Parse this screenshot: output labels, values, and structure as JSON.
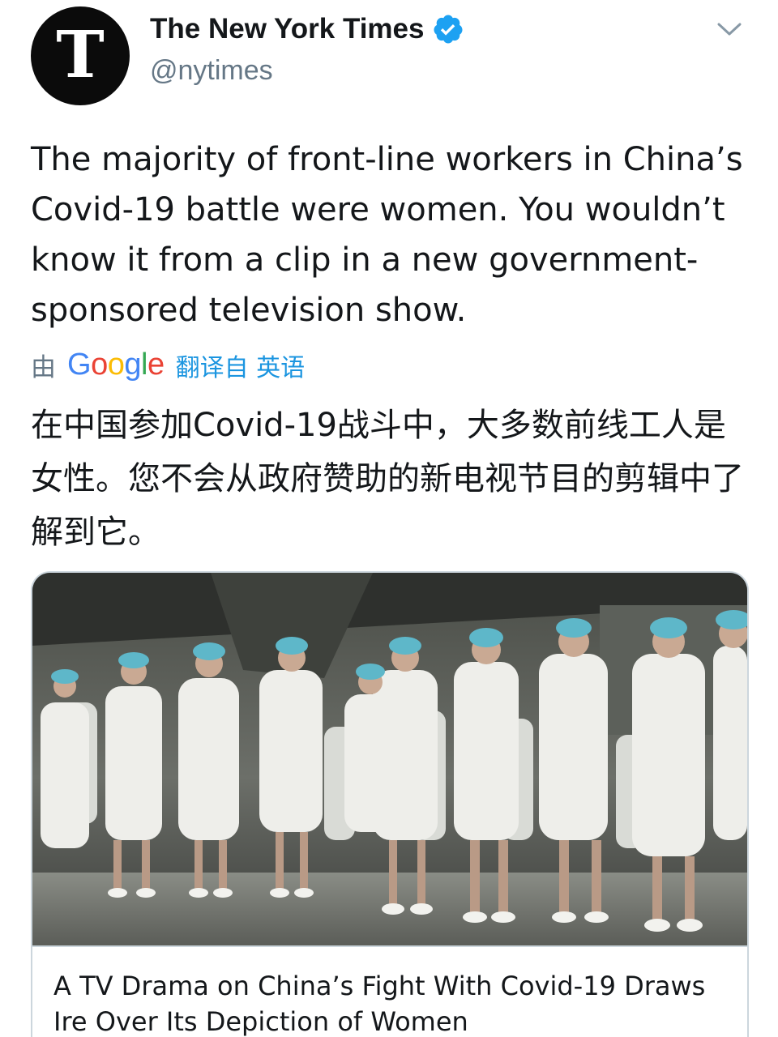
{
  "account": {
    "display_name": "The New York Times",
    "handle": "@nytimes",
    "verified": true,
    "avatar_icon": "nyt-logo-icon",
    "avatar_letter": "T"
  },
  "tweet": {
    "text": "The majority of front-line workers in China’s Covid-19 battle were women. You wouldn’t know it from a clip in a new government-sponsored television show.",
    "translation": {
      "prefix": "由",
      "provider": "Google",
      "link_text": "翻译自 英语",
      "text": "在中国参加Covid-19战斗中，大多数前线工人是女性。您不会从政府赞助的新电视节目的剪辑中了解到它。"
    }
  },
  "link_card": {
    "image_alt_icon": "nurses-photo-icon",
    "title": "A TV Drama on China’s Fight With Covid-19 Draws Ire Over Its Depiction of Women"
  },
  "colors": {
    "text": "#14171a",
    "secondary": "#657786",
    "link": "#1b95e0",
    "verified": "#1da1f2",
    "border": "#ccd6dd"
  }
}
